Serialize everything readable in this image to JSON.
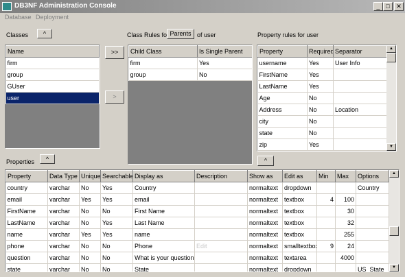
{
  "window": {
    "title": "DB3NF Administration Console",
    "min": "_",
    "max": "□",
    "close": "✕"
  },
  "menu": [
    "Database",
    "Deployment"
  ],
  "classes": {
    "label": "Classes",
    "sort_button": "^",
    "header": "Name",
    "items": [
      "firm",
      "group",
      "GUser",
      "user"
    ],
    "selected_index": 3
  },
  "mid_buttons": {
    "add": ">>",
    "remove": ">"
  },
  "class_rules": {
    "label_prefix": "Class Rules for",
    "mode_button": "Parents",
    "label_suffix": "of user",
    "headers": [
      "Child Class",
      "Is Single Parent"
    ],
    "rows": [
      [
        "firm",
        "Yes"
      ],
      [
        "group",
        "No"
      ]
    ]
  },
  "property_rules": {
    "label": "Property rules for user",
    "headers": [
      "Property",
      "Required",
      "Separator"
    ],
    "rows": [
      [
        "username",
        "Yes",
        "User Info"
      ],
      [
        "FirstName",
        "Yes",
        ""
      ],
      [
        "LastName",
        "Yes",
        ""
      ],
      [
        "Age",
        "No",
        ""
      ],
      [
        "Address",
        "No",
        "Location"
      ],
      [
        "city",
        "No",
        ""
      ],
      [
        "state",
        "No",
        ""
      ],
      [
        "zip",
        "Yes",
        ""
      ]
    ],
    "up_button": "^"
  },
  "properties": {
    "label": "Properties",
    "sort_button": "^",
    "headers": [
      "Property",
      "Data Type",
      "Unique",
      "Searchable",
      "Display as",
      "Description",
      "Show as",
      "Edit as",
      "Min",
      "Max",
      "Options"
    ],
    "rows": [
      [
        "country",
        "varchar",
        "No",
        "Yes",
        "Country",
        "",
        "normaltext",
        "dropdown",
        "",
        "",
        "Country"
      ],
      [
        "email",
        "varchar",
        "Yes",
        "Yes",
        "email",
        "",
        "normaltext",
        "textbox",
        "4",
        "100",
        ""
      ],
      [
        "FirstName",
        "varchar",
        "No",
        "No",
        "First Name",
        "",
        "normaltext",
        "textbox",
        "",
        "30",
        ""
      ],
      [
        "LastName",
        "varchar",
        "No",
        "Yes",
        "Last Name",
        "",
        "normaltext",
        "textbox",
        "",
        "32",
        ""
      ],
      [
        "name",
        "varchar",
        "Yes",
        "Yes",
        "name",
        "",
        "normaltext",
        "textbox",
        "",
        "255",
        ""
      ],
      [
        "phone",
        "varchar",
        "No",
        "No",
        "Phone",
        "Edit",
        "normaltext",
        "smalltextbox",
        "9",
        "24",
        ""
      ],
      [
        "question",
        "varchar",
        "No",
        "No",
        "What is your question?",
        "",
        "normaltext",
        "textarea",
        "",
        "4000",
        ""
      ],
      [
        "state",
        "varchar",
        "No",
        "No",
        "State",
        "",
        "normaltext",
        "dropdown",
        "",
        "",
        "US_State"
      ]
    ]
  },
  "colors": {
    "selection": "#0a246a",
    "face": "#d4d0c8",
    "title_from": "#7f7f7f",
    "title_to": "#b8b8b8"
  }
}
